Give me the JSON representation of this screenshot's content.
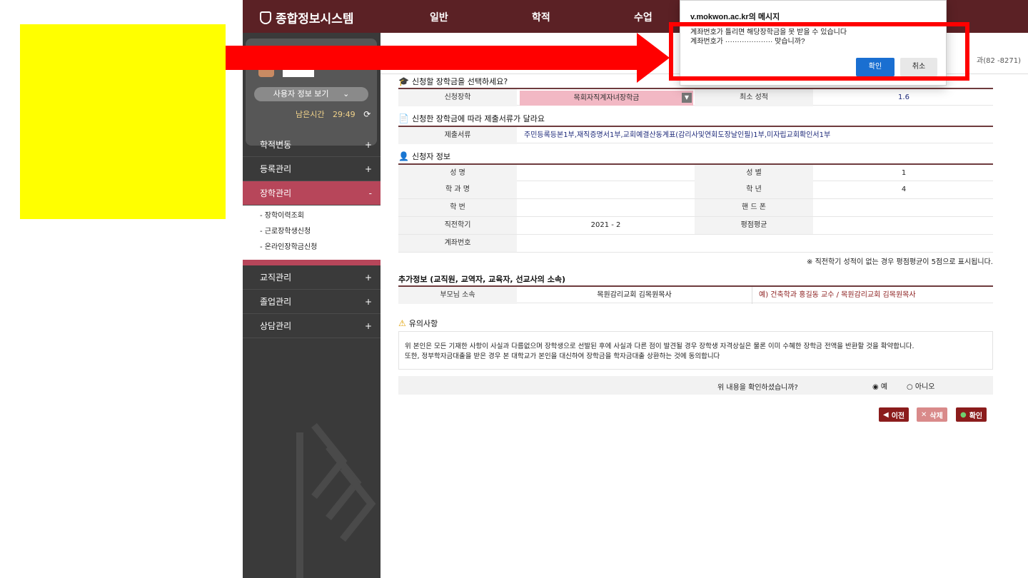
{
  "header": {
    "logo": "종합정보시스템",
    "nav": [
      "일반",
      "학적",
      "수업"
    ]
  },
  "sidebar": {
    "user_info_button": "사용자 정보 보기",
    "remain_label": "남은시간",
    "remain_time": "29:49",
    "menu": [
      {
        "label": "학적변동",
        "sign": "+"
      },
      {
        "label": "등록관리",
        "sign": "+"
      },
      {
        "label": "장학관리",
        "sign": "-"
      },
      {
        "label": "교직관리",
        "sign": "+"
      },
      {
        "label": "졸업관리",
        "sign": "+"
      },
      {
        "label": "상담관리",
        "sign": "+"
      }
    ],
    "submenu": [
      "- 장학이력조회",
      "- 근로장학생신청",
      "- 온라인장학금신청"
    ]
  },
  "page": {
    "dept_tail": "과(82 -8271)"
  },
  "scholarship": {
    "section_title": "신청할 장학금을 선택하세요?",
    "apply_label": "신청장학",
    "apply_value": "목회자직계자녀장학금",
    "min_grade_label": "최소 성적",
    "min_grade_value": "1.6"
  },
  "documents": {
    "section_title": "신청한 장학금에 따라 제출서류가 달라요",
    "label": "제출서류",
    "value": "주민등록등본1부,재직증명서1부,교회예결산동계표(감리사및연회도장날인필)1부,미자립교회확인서1부"
  },
  "applicant": {
    "section_title": "신청자 정보",
    "name_label": "성 명",
    "gender_label": "성 별",
    "gender_value": "1",
    "dept_label": "학 과 명",
    "year_label": "학 년",
    "year_value": "4",
    "id_label": "학 번",
    "phone_label": "핸 드 폰",
    "prev_sem_label": "직전학기",
    "prev_sem_value": "2021 - 2",
    "gpa_label": "평점평균",
    "account_label": "계좌번호",
    "note": "※ 직전학기 성적이 없는 경우 평점평균이 5점으로 표시됩니다."
  },
  "extra": {
    "section_title": "추가정보 (교직원, 교역자, 교육자, 선교사의 소속)",
    "label": "부모님 소속",
    "value": "목원감리교회 김목원목사",
    "example": "예) 건축학과 홍길동 교수 / 목원감리교회 김목원목사"
  },
  "caution": {
    "title": "유의사항",
    "line1": "위 본인은 모든 기재한 사항이 사실과 다름없으며 장학생으로 선발된 후에 사실과 다른 점이 발견될 경우 장학생 자격상실은 물론 이미 수혜한 장학금 전액을 반환할 것을 확약합니다.",
    "line2": "또한, 정부학자금대출을 받은 경우 본 대학교가 본인을 대신하여 장학금을 학자금대출 상환하는 것에 동의합니다"
  },
  "confirm": {
    "question": "위 내용을 확인하셨습니까?",
    "yes": "예",
    "no": "아니오"
  },
  "buttons": {
    "prev": "이전",
    "delete": "삭제",
    "ok": "확인"
  },
  "dialog": {
    "title": "v.mokwon.ac.kr의 메시지",
    "line1": "계좌번호가 틀리면 해당장학금을 못 받을 수 있습니다",
    "line2": "계좌번호가 ···················· 맞습니까?",
    "ok": "확인",
    "cancel": "취소"
  },
  "colors": {
    "brand": "#5b2125",
    "accent": "#b7465a",
    "annotation_red": "#ff0000",
    "annotation_yellow": "#ffff00"
  }
}
